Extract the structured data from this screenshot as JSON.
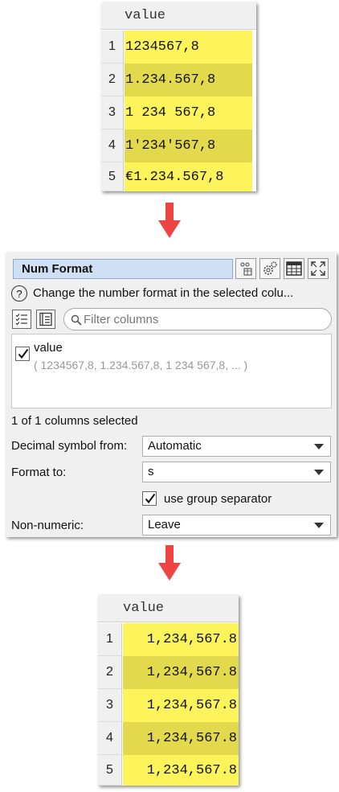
{
  "input_table": {
    "header": "value",
    "rows": [
      {
        "num": "1",
        "value": "1234567,8"
      },
      {
        "num": "2",
        "value": "1.234.567,8"
      },
      {
        "num": "3",
        "value": "1 234 567,8"
      },
      {
        "num": "4",
        "value": "1'234'567,8"
      },
      {
        "num": "5",
        "value": "€1.234.567,8"
      }
    ]
  },
  "dialog": {
    "title": "Num Format",
    "help_symbol": "?",
    "description": "Change the number format in the selected colu...",
    "filter_placeholder": "Filter columns",
    "columns": [
      {
        "name": "value",
        "sample": "( 1234567,8, 1.234.567,8, 1 234 567,8, ... )",
        "checked": true
      }
    ],
    "selected_count": "1 of 1 columns selected",
    "decimal_label": "Decimal symbol from:",
    "decimal_value": "Automatic",
    "format_label": "Format to:",
    "format_value": "s",
    "group_sep_label": "use group separator",
    "group_sep_checked": true,
    "nonnumeric_label": "Non-numeric:",
    "nonnumeric_value": "Leave"
  },
  "output_table": {
    "header": "value",
    "rows": [
      {
        "num": "1",
        "value": "1,234,567.8"
      },
      {
        "num": "2",
        "value": "1,234,567.8"
      },
      {
        "num": "3",
        "value": "1,234,567.8"
      },
      {
        "num": "4",
        "value": "1,234,567.8"
      },
      {
        "num": "5",
        "value": "1,234,567.8"
      }
    ]
  },
  "colors": {
    "cell_light": "#fdf35a",
    "cell_dark": "#e3d94c",
    "arrow": "#ee4444",
    "title_bg": "#cfe0f4"
  }
}
